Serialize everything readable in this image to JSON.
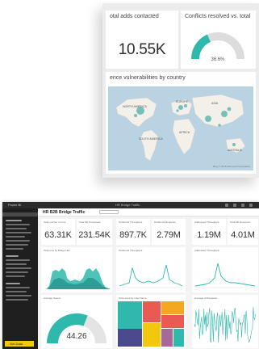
{
  "collage": {
    "tile_a": {
      "title": "otal adds contacted",
      "value": "10.55K"
    },
    "tile_b": {
      "title": "Conflicts resolved vs. total",
      "gauge_value": "36.6%",
      "gauge_fraction": 0.37
    },
    "tile_c": {
      "title": "ence vulnerabilities by country",
      "map_labels": [
        "NORTH AMERICA",
        "EUROPE",
        "ASIA",
        "AFRICA",
        "SOUTH AMERICA",
        "AUSTRALIA"
      ],
      "bubble_color": "#5fb8b2",
      "footer": "Bing © 2016 Microsoft Corporation"
    }
  },
  "dashboard": {
    "app_name": "Power BI",
    "doc_title": "HR Bridge Traffic",
    "header_title": "HR B2B Bridge Traffic",
    "get_data_label": "Get Data",
    "accent_color": "#2fb8ac",
    "kpis": [
      {
        "title": "Total number of runs",
        "value": "63.31K"
      },
      {
        "title": "Total Mb Processed",
        "value": "231.54K"
      },
      {
        "title": "Outbound Throughput",
        "value": "897.7K"
      },
      {
        "title": "Outbound Requests",
        "value": "2.79M"
      },
      {
        "title": "Addressed Throughput",
        "value": "1.19M"
      },
      {
        "title": "Total Mb Received",
        "value": "4.01M"
      }
    ],
    "charts": [
      {
        "title": "Total runs by Bridge Hub"
      },
      {
        "title": "Outbound Throughput"
      },
      {
        "title": "Addressed Throughput"
      }
    ],
    "gauge": {
      "title": "Average Speed",
      "value": "44.26",
      "fraction": 0.62
    },
    "treemap": {
      "title": "Total count by User Name"
    },
    "noise": {
      "title": "Average of Requests"
    }
  }
}
